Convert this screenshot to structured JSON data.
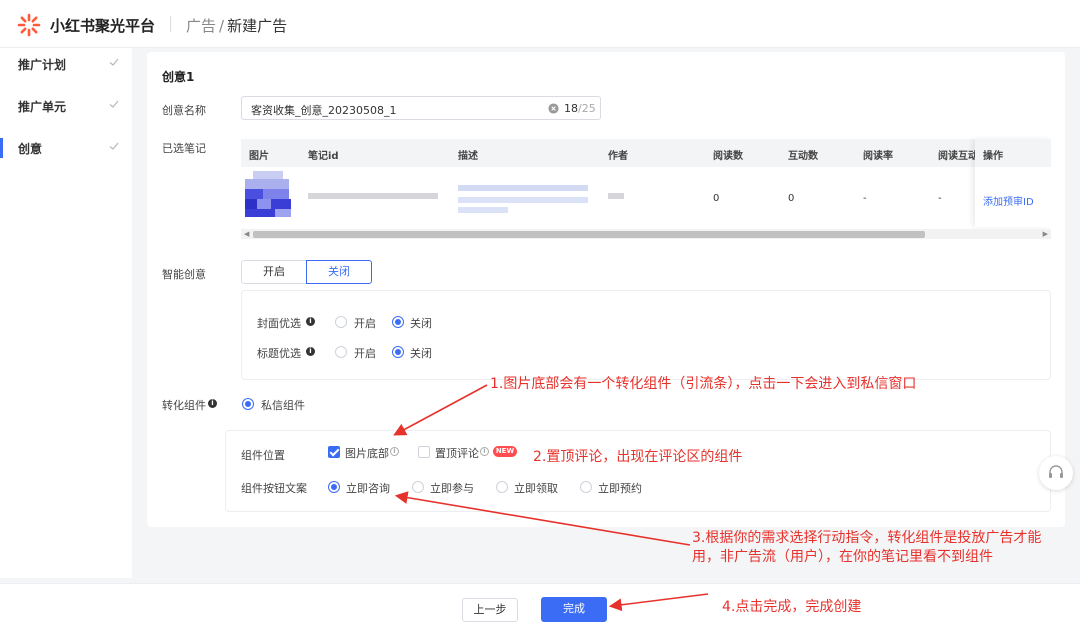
{
  "header": {
    "brand": "小红书聚光平台",
    "breadcrumb_parent": "广告",
    "breadcrumb_sep": "/",
    "breadcrumb_current": "新建广告"
  },
  "sidebar": {
    "items": [
      {
        "label": "推广计划"
      },
      {
        "label": "推广单元"
      },
      {
        "label": "创意"
      }
    ]
  },
  "creative": {
    "title": "创意1",
    "name_label": "创意名称",
    "name_value": "客资收集_创意_20230508_1",
    "name_count": "18",
    "name_max": "/25",
    "notes_label": "已选笔记",
    "table": {
      "headers": [
        "图片",
        "笔记id",
        "描述",
        "作者",
        "阅读数",
        "互动数",
        "阅读率",
        "阅读互动率",
        "操作"
      ],
      "row": {
        "reads": "0",
        "interactions": "0",
        "read_rate": "-",
        "interaction_rate": "-",
        "action": "添加预审ID"
      }
    },
    "smart_label": "智能创意",
    "smart_options": [
      "开启",
      "关闭"
    ],
    "smart_selected": "关闭",
    "cover_label": "封面优选",
    "title_opt_label": "标题优选",
    "on_label": "开启",
    "off_label": "关闭",
    "convert_label": "转化组件",
    "convert_option": "私信组件",
    "position_label": "组件位置",
    "position_options": [
      {
        "label": "图片底部",
        "checked": true
      },
      {
        "label": "置顶评论",
        "checked": false,
        "badge": "NEW"
      }
    ],
    "button_text_label": "组件按钮文案",
    "button_text_options": [
      "立即咨询",
      "立即参与",
      "立即领取",
      "立即预约"
    ],
    "button_text_selected": "立即咨询"
  },
  "annotations": {
    "a1": "1.图片底部会有一个转化组件（引流条），点击一下会进入到私信窗口",
    "a2": "2.置顶评论，出现在评论区的组件",
    "a3_line1": "3.根据你的需求选择行动指令，转化组件是投放广告才能",
    "a3_line2": "用，非广告流（用户），在你的笔记里看不到组件",
    "a4": "4.点击完成，完成创建"
  },
  "footer": {
    "prev": "上一步",
    "done": "完成"
  },
  "colors": {
    "accent": "#3b6cf5",
    "annotation": "#e7322c",
    "brand_logo": "#ff2442"
  }
}
